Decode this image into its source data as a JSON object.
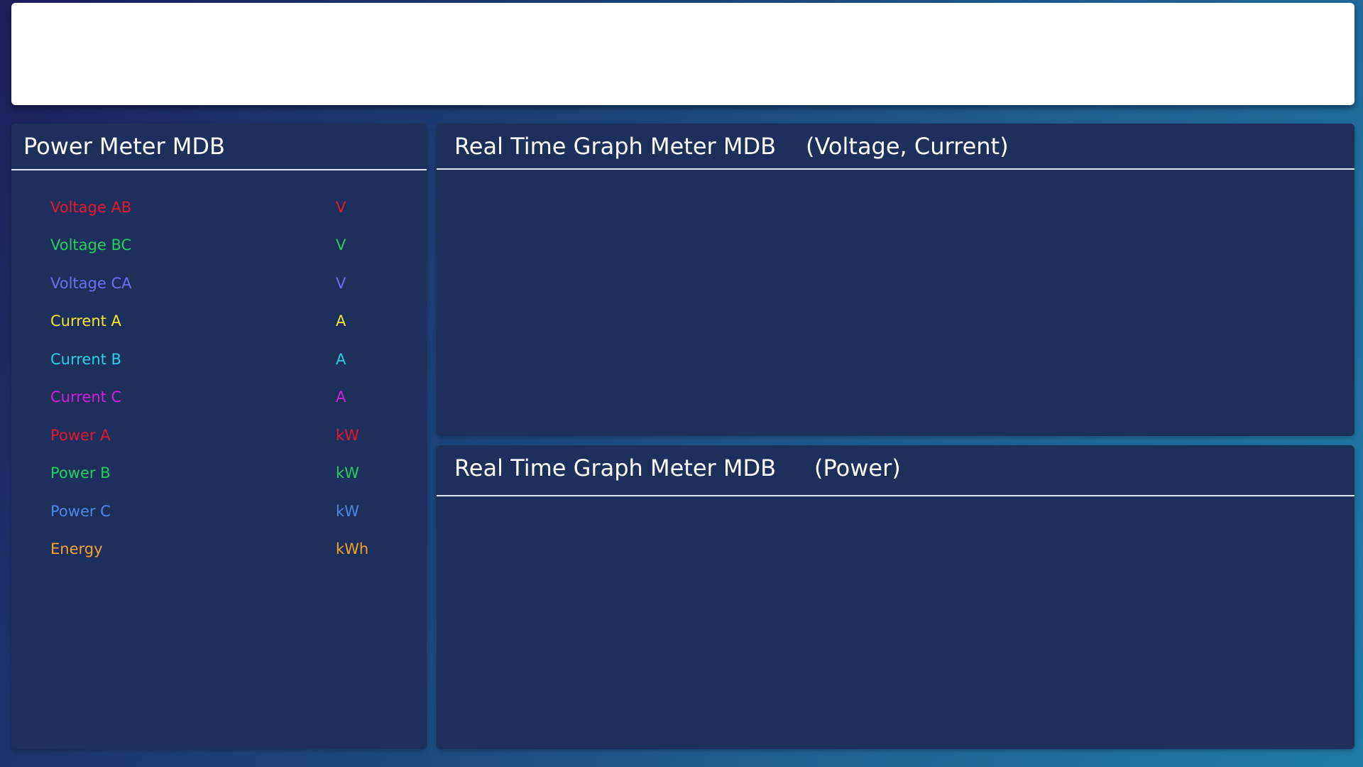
{
  "header": {},
  "meter_panel": {
    "title": "Power Meter MDB",
    "rows": [
      {
        "label": "Voltage AB",
        "unit": "V",
        "color": "#e2182d"
      },
      {
        "label": "Voltage BC",
        "unit": "V",
        "color": "#1fd15a"
      },
      {
        "label": "Voltage CA",
        "unit": "V",
        "color": "#6a6ff0"
      },
      {
        "label": "Current A",
        "unit": "A",
        "color": "#f4e52a"
      },
      {
        "label": "Current B",
        "unit": "A",
        "color": "#25d0e8"
      },
      {
        "label": "Current C",
        "unit": "A",
        "color": "#d21ee0"
      },
      {
        "label": "Power A",
        "unit": "kW",
        "color": "#e2182d"
      },
      {
        "label": "Power B",
        "unit": "kW",
        "color": "#1fd15a"
      },
      {
        "label": "Power C",
        "unit": "kW",
        "color": "#4f86ea"
      },
      {
        "label": "Energy",
        "unit": "kWh",
        "color": "#f0a22c"
      }
    ]
  },
  "graph_panel_vc": {
    "title": "Real Time Graph Meter MDB",
    "subtitle": "(Voltage, Current)"
  },
  "graph_panel_power": {
    "title": "Real Time Graph Meter MDB",
    "subtitle": "(Power)"
  }
}
